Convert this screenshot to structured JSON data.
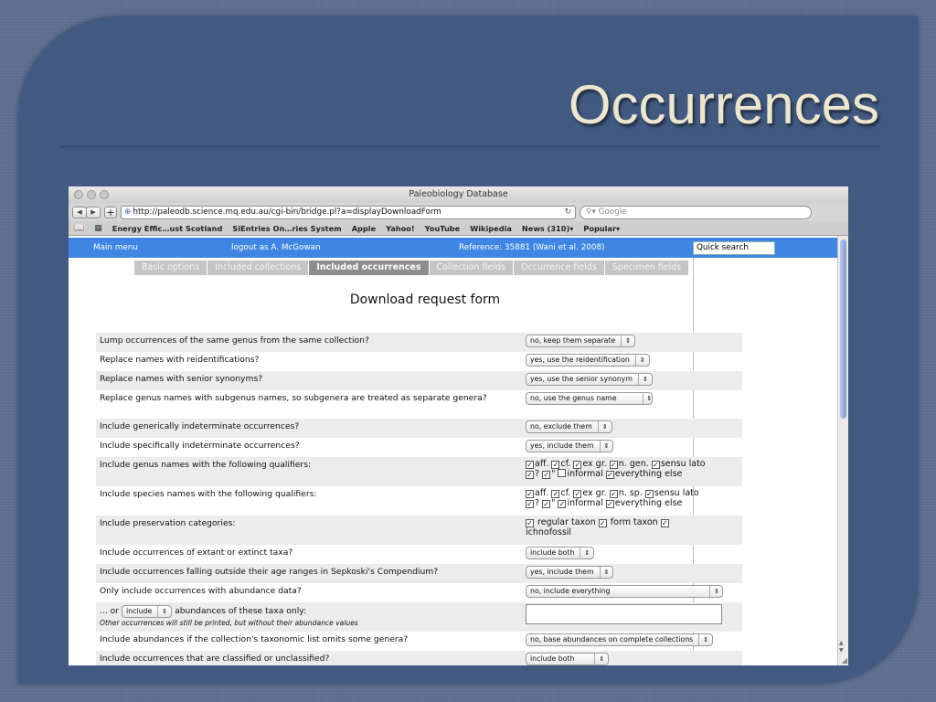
{
  "slide": {
    "title": "Occurrences"
  },
  "browser": {
    "window_title": "Paleobiology Database",
    "url": "http://paleodb.science.mq.edu.au/cgi-bin/bridge.pl?a=displayDownloadForm",
    "search_placeholder": "Google",
    "bookmarks": [
      "Energy Effic…ust Scotland",
      "SiEntries On…ries System",
      "Apple",
      "Yahoo!",
      "YouTube",
      "Wikipedia",
      "News (310)▾",
      "Popular▾"
    ]
  },
  "page": {
    "menu": {
      "main_menu": "Main menu",
      "logout": "logout as A. McGowan",
      "reference": "Reference: 35881 (Wani et al. 2008)",
      "quick_search": "Quick search"
    },
    "tabs": [
      {
        "label": "Basic options",
        "active": false
      },
      {
        "label": "Included collections",
        "active": false
      },
      {
        "label": "Included occurrences",
        "active": true
      },
      {
        "label": "Collection fields",
        "active": false
      },
      {
        "label": "Occurrence fields",
        "active": false
      },
      {
        "label": "Specimen fields",
        "active": false
      }
    ],
    "form_title": "Download request form",
    "questions": {
      "lump": {
        "label": "Lump occurrences of the same genus from the same collection?",
        "value": "no, keep them separate"
      },
      "reid": {
        "label": "Replace names with reidentifications?",
        "value": "yes, use the reidentification"
      },
      "senior": {
        "label": "Replace names with senior synonyms?",
        "value": "yes, use the senior synonym"
      },
      "subgenus": {
        "label": "Replace genus names with subgenus names, so subgenera are treated as separate genera?",
        "value": "no, use the genus name"
      },
      "generic_indet": {
        "label": "Include generically indeterminate occurrences?",
        "value": "no, exclude them"
      },
      "specific_indet": {
        "label": "Include specifically indeterminate occurrences?",
        "value": "yes, include them"
      },
      "genus_qual": {
        "label": "Include genus names with the following qualifiers:",
        "line1": [
          {
            "text": "aff.",
            "checked": true
          },
          {
            "text": "cf.",
            "checked": true
          },
          {
            "text": "ex gr.",
            "checked": true
          },
          {
            "text": "n. gen.",
            "checked": true
          },
          {
            "text": "sensu lato",
            "checked": true
          }
        ],
        "line2": [
          {
            "text": "?",
            "checked": true
          },
          {
            "text": "\"",
            "checked": true
          },
          {
            "text": "informal",
            "checked": false
          },
          {
            "text": "everything else",
            "checked": true
          }
        ]
      },
      "species_qual": {
        "label": "Include species names with the following qualifiers:",
        "line1": [
          {
            "text": "aff.",
            "checked": true
          },
          {
            "text": "cf.",
            "checked": true
          },
          {
            "text": "ex gr.",
            "checked": true
          },
          {
            "text": "n. sp.",
            "checked": true
          },
          {
            "text": "sensu lato",
            "checked": true
          }
        ],
        "line2": [
          {
            "text": "?",
            "checked": true
          },
          {
            "text": "\"",
            "checked": true
          },
          {
            "text": "informal",
            "checked": true
          },
          {
            "text": "everything else",
            "checked": true
          }
        ]
      },
      "preservation": {
        "label": "Include preservation categories:",
        "regular": "regular taxon",
        "form": "form taxon",
        "ichno": "ichnofossil"
      },
      "extant": {
        "label": "Include occurrences of extant or extinct taxa?",
        "value": "include both"
      },
      "sepkoski": {
        "label": "Include occurrences falling outside their age ranges in Sepkoski's Compendium?",
        "value": "yes, include them"
      },
      "abundance_only": {
        "label": "Only include occurrences with abundance data?",
        "value": "no, include everything"
      },
      "abund_taxa": {
        "prefix": "... or",
        "select": "include",
        "suffix": "abundances of these taxa only:",
        "note": "Other occurrences will still be printed, but without their abundance values"
      },
      "abund_omits": {
        "label": "Include abundances if the collection's taxonomic list omits some genera?",
        "value": "no, base abundances on complete collections"
      },
      "classified": {
        "label": "Include occurrences that are classified or unclassified?",
        "value": "include both"
      }
    }
  }
}
